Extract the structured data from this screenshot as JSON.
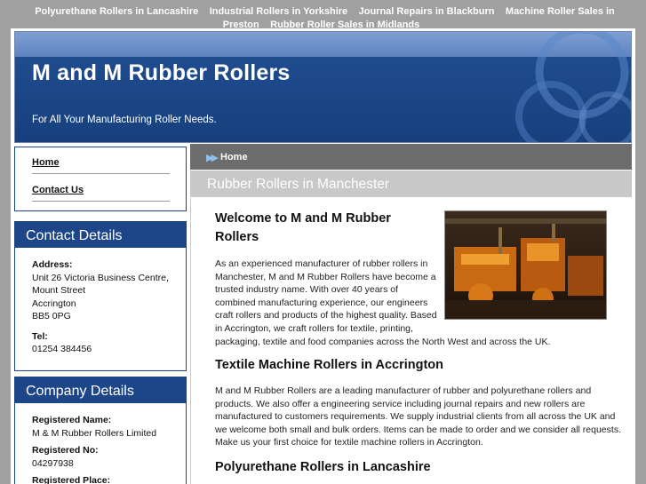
{
  "topnav": [
    {
      "label": "Polyurethane Rollers in Lancashire"
    },
    {
      "label": "Industrial Rollers in Yorkshire"
    },
    {
      "label": "Journal Repairs in Blackburn"
    },
    {
      "label": "Machine Roller Sales in Preston"
    },
    {
      "label": "Rubber Roller Sales in Midlands"
    }
  ],
  "header": {
    "title": "M and M Rubber Rollers",
    "tagline": "For All Your Manufacturing Roller Needs."
  },
  "sidebar": {
    "nav": [
      {
        "label": "Home"
      },
      {
        "label": "Contact Us"
      }
    ],
    "contact": {
      "heading": "Contact Details",
      "address_label": "Address:",
      "address_lines": [
        "Unit 26 Victoria Business Centre,",
        "Mount Street",
        "Accrington",
        "BB5 0PG"
      ],
      "tel_label": "Tel:",
      "tel": "01254 384456"
    },
    "company": {
      "heading": "Company Details",
      "reg_name_label": "Registered Name:",
      "reg_name": "M & M Rubber Rollers Limited",
      "reg_no_label": "Registered No:",
      "reg_no": "04297938",
      "reg_place_label": "Registered Place:"
    }
  },
  "breadcrumb": {
    "current": "Home"
  },
  "page_heading": "Rubber Rollers in Manchester",
  "content": {
    "welcome_heading_l1": "Welcome to M and M Rubber",
    "welcome_heading_l2": "Rollers",
    "welcome_lines": [
      "As an experienced manufacturer of rubber rollers in",
      "Manchester, M and M Rubber Rollers have become a",
      "trusted industry name. With over 40 years of",
      "combined manufacturing experience, our engineers",
      "craft rollers and products of the highest quality. Based",
      "in Accrington, we craft rollers for textile, printing,",
      "packaging, textile and food companies across the North West and across the UK."
    ],
    "textile_heading": "Textile Machine Rollers in Accrington",
    "textile_lines": [
      "M and M Rubber Rollers are a leading manufacturer of rubber and polyurethane rollers and",
      "products. We also offer a engineering service including journal repairs and new rollers are",
      "manufactured to customers requirements. We supply industrial clients from all across the UK and",
      "we welcome both small and bulk orders. Items can be made to order and we consider all requests.",
      "Make us your first choice for textile machine rollers in Accrington."
    ],
    "poly_heading": "Polyurethane Rollers in Lancashire"
  },
  "colors": {
    "header_blue": "#1f4c8f",
    "box_head_blue": "#1d4688",
    "crumb_bar": "#6c6c6c",
    "page_bg": "#a0a0a0"
  },
  "icons": {
    "breadcrumb": "double-arrow-icon",
    "photo": "machinery-photo"
  }
}
